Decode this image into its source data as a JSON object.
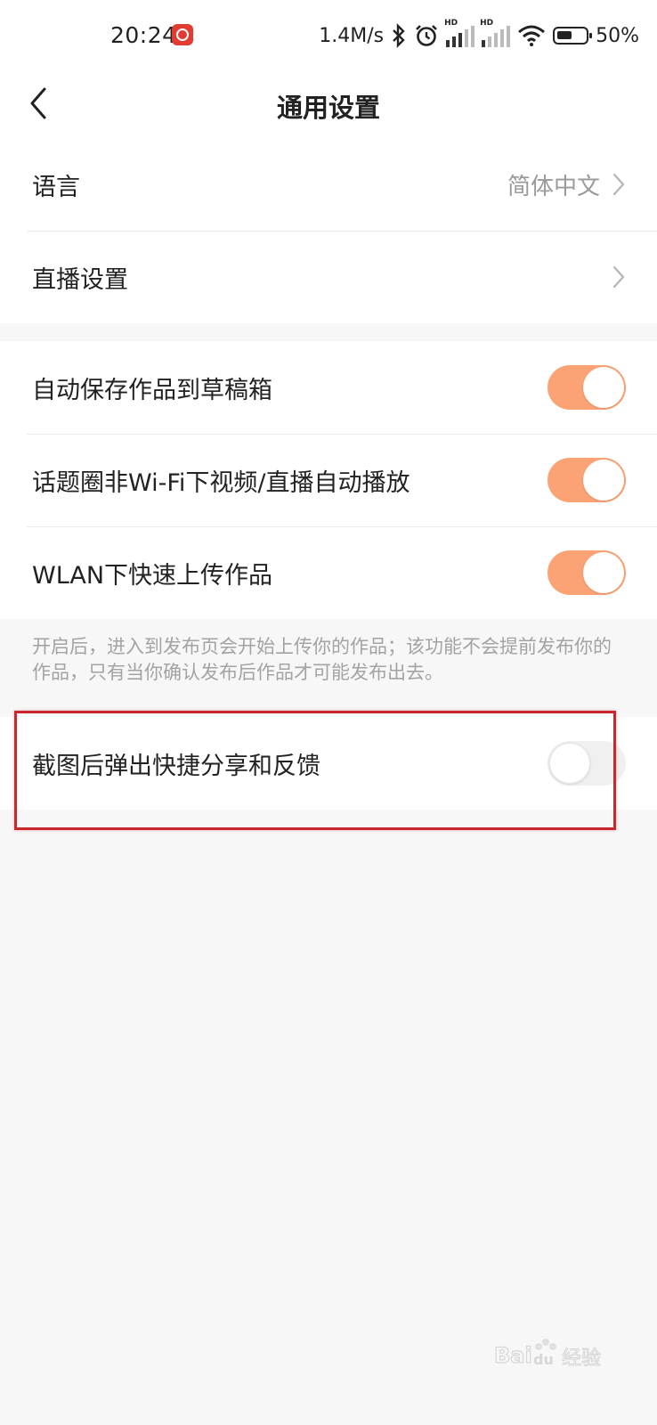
{
  "status_bar": {
    "time": "20:24",
    "net_speed": "1.4M/s",
    "sim1_tag": "HD",
    "sim2_tag": "HD",
    "battery": "50%"
  },
  "nav": {
    "title": "通用设置"
  },
  "group1": [
    {
      "label": "语言",
      "value": "简体中文"
    },
    {
      "label": "直播设置",
      "value": ""
    }
  ],
  "group2": [
    {
      "label": "自动保存作品到草稿箱",
      "on": true
    },
    {
      "label": "话题圈非Wi-Fi下视频/直播自动播放",
      "on": true
    },
    {
      "label": "WLAN下快速上传作品",
      "on": true
    }
  ],
  "hint": "开启后，进入到发布页会开始上传你的作品；该功能不会提前发布你的作品，只有当你确认发布后作品才可能发布出去。",
  "group3": [
    {
      "label": "截图后弹出快捷分享和反馈",
      "on": false
    }
  ],
  "colors": {
    "accent": "#fca376",
    "highlight": "#c8282d"
  },
  "watermark": "Baidu经验"
}
